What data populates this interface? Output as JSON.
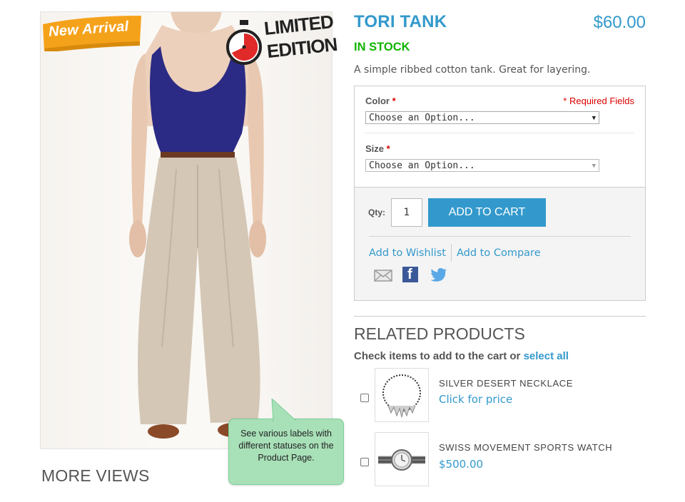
{
  "badges": {
    "new_arrival": "New Arrival",
    "limited_line1": "LIMITED",
    "limited_line2": "EDITION"
  },
  "callout": {
    "text": "See various labels with different statuses on the Product Page."
  },
  "more_views_title": "MORE VIEWS",
  "product": {
    "name": "TORI TANK",
    "price": "$60.00",
    "stock": "IN STOCK",
    "description": "A simple ribbed cotton tank. Great for layering."
  },
  "options": {
    "required_note": "* Required Fields",
    "color": {
      "label": "Color",
      "star": "*",
      "value": "Choose an Option..."
    },
    "size": {
      "label": "Size",
      "star": "*",
      "value": "Choose an Option..."
    }
  },
  "cart": {
    "qty_label": "Qty:",
    "qty_value": "1",
    "add_to_cart": "ADD TO CART",
    "wishlist": "Add to Wishlist",
    "compare": "Add to Compare",
    "share_icons": [
      "email-icon",
      "facebook-icon",
      "twitter-icon"
    ]
  },
  "related": {
    "title": "RELATED PRODUCTS",
    "subtitle": "Check items to add to the cart or",
    "select_all": "select all",
    "items": [
      {
        "name": "SILVER DESERT NECKLACE",
        "price": "Click for price"
      },
      {
        "name": "SWISS MOVEMENT SPORTS WATCH",
        "price": "$500.00"
      }
    ]
  },
  "colors": {
    "accent": "#3399cc",
    "in_stock": "#11b400",
    "required": "#dd0000",
    "badge_orange": "#f5a21b",
    "callout_green": "#a8e0b8"
  }
}
